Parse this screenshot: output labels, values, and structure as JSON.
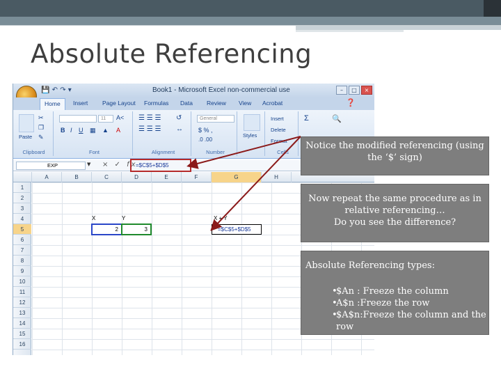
{
  "slide": {
    "title": "Absolute Referencing"
  },
  "excel": {
    "window_title": "Book1 - Microsoft Excel non-commercial use",
    "ribbon_tabs": [
      "Home",
      "Insert",
      "Page Layout",
      "Formulas",
      "Data",
      "Review",
      "View",
      "Acrobat"
    ],
    "active_tab": "Home",
    "groups": {
      "clipboard": "Clipboard",
      "font": "Font",
      "alignment": "Alignment",
      "number": "Number",
      "cells": "Cells",
      "styles": "Styles",
      "paste": "Paste"
    },
    "font_size": "11",
    "number_format": "General",
    "cells_buttons": [
      "Insert",
      "Delete",
      "Format"
    ],
    "name_box": "EXP",
    "formula_bar": "=$C$5+$D$5",
    "columns": [
      "A",
      "B",
      "C",
      "D",
      "E",
      "F",
      "G",
      "H"
    ],
    "rows": [
      "1",
      "2",
      "3",
      "4",
      "5",
      "6",
      "7",
      "8",
      "9",
      "10",
      "11",
      "12",
      "13",
      "14",
      "15",
      "16"
    ],
    "cells": {
      "b4": "X",
      "c4": "Y",
      "f4": "X + Y",
      "c5": "2",
      "d5": "3",
      "f5": "=$C$5+$D$5"
    }
  },
  "callouts": {
    "c1": "Notice the modified referencing (using the ‘$’ sign)",
    "c2_line1": "Now repeat the same procedure as in relative referencing…",
    "c2_line2": "Do you see the difference?",
    "c3_title": "Absolute Referencing types:",
    "c3_items": [
      "$An  : Freeze the column",
      "A$n  :Freeze the row",
      "$A$n:Freeze the column and the row"
    ]
  },
  "colors": {
    "arrow": "#8b1a1a",
    "callout_bg": "#7e7e7e",
    "formula_highlight": "#b52a2a"
  }
}
